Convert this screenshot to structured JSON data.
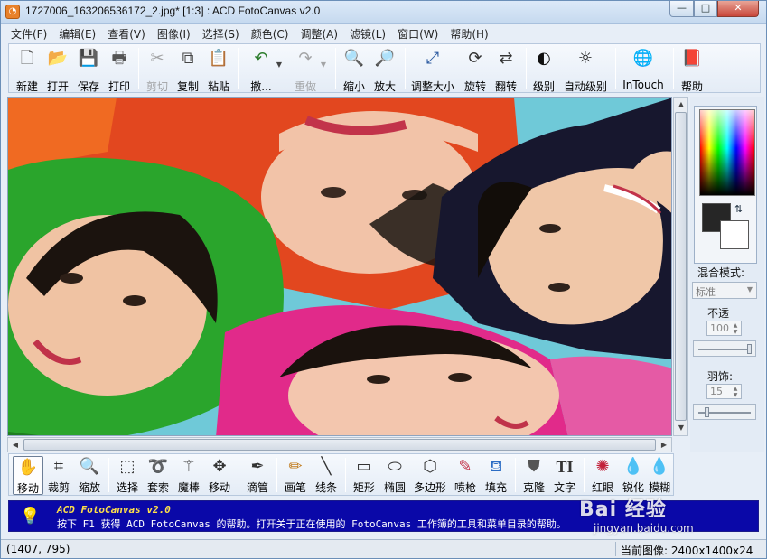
{
  "titlebar": {
    "title": "1727006_163206536172_2.jpg* [1:3] : ACD FotoCanvas v2.0",
    "minimize": "—",
    "maximize": "□",
    "close": "✕"
  },
  "menu": [
    "文件(F)",
    "编辑(E)",
    "查看(V)",
    "图像(I)",
    "选择(S)",
    "颜色(C)",
    "调整(A)",
    "滤镜(L)",
    "窗口(W)",
    "帮助(H)"
  ],
  "toolbar": {
    "new": "新建",
    "open": "打开",
    "save": "保存",
    "print": "打印",
    "cut": "剪切",
    "copy": "复制",
    "paste": "粘贴",
    "undo": "撤...",
    "redo": "重做",
    "zoom_out": "缩小",
    "zoom_in": "放大",
    "resize": "调整大小",
    "rotate": "旋转",
    "flip": "翻转",
    "levels": "级别",
    "auto_levels": "自动级别",
    "intouch": "InTouch",
    "help": "帮助"
  },
  "right_panel": {
    "blend_mode_label": "混合模式:",
    "blend_mode_value": "标准",
    "opacity_label": "不透",
    "opacity_value": "100",
    "feather_label": "羽饰:",
    "feather_value": "15"
  },
  "tools": {
    "move": "移动",
    "crop": "裁剪",
    "zoom": "缩放",
    "select": "选择",
    "lasso": "套索",
    "magic_wand": "魔棒",
    "move2": "移动",
    "eyedropper": "滴管",
    "pencil": "画笔",
    "line": "线条",
    "rectangle": "矩形",
    "ellipse": "椭圆",
    "polygon": "多边形",
    "airbrush": "喷枪",
    "fill": "填充",
    "clone": "克隆",
    "text": "文字",
    "red_eye": "红眼",
    "sharpen": "锐化",
    "blur": "模糊"
  },
  "helpbar": {
    "title": "ACD FotoCanvas v2.0",
    "text": "按下 F1 获得 ACD FotoCanvas 的帮助。打开关于正在使用的 FotoCanvas 工作簿的工具和菜单目录的帮助。"
  },
  "statusbar": {
    "coords": "(1407, 795)",
    "image_info": "当前图像: 2400x1400x24"
  },
  "watermark": {
    "main": "Bai 经验",
    "sub": "jingyan.baidu.com"
  },
  "colors": {
    "title_bg": "#c5d9ef",
    "help_bg": "#0a08a8",
    "help_title": "#ffe14a",
    "fg_color": "#262626",
    "bg_color": "#ffffff"
  }
}
